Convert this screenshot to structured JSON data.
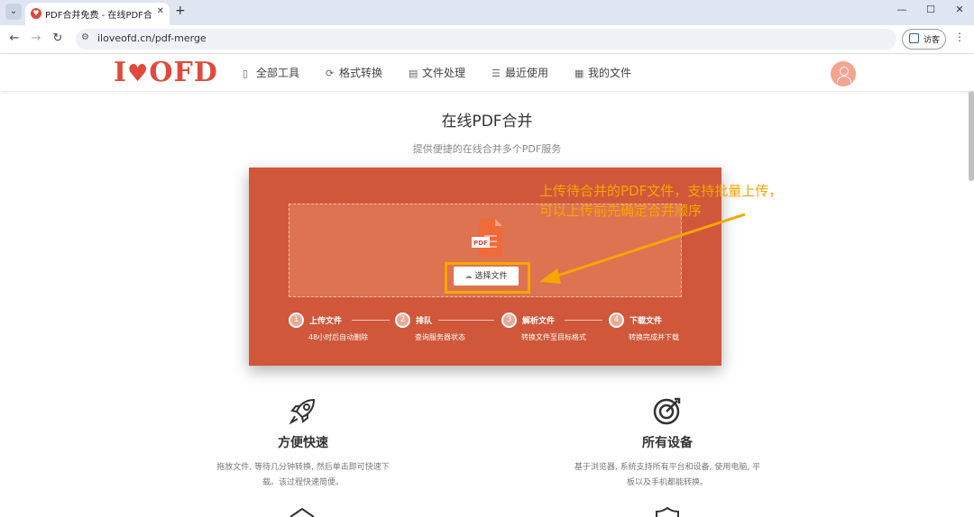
{
  "browser": {
    "tab_title": "PDF合并免费 - 在线PDF合并工",
    "url": "iloveofd.cn/pdf-merge",
    "guest_label": "访客"
  },
  "site": {
    "logo_text_1": "I",
    "logo_text_2": "OFD",
    "nav": [
      {
        "label": "全部工具",
        "icon": "grid-icon"
      },
      {
        "label": "格式转换",
        "icon": "convert-icon"
      },
      {
        "label": "文件处理",
        "icon": "file-process-icon"
      },
      {
        "label": "最近使用",
        "icon": "recent-icon"
      },
      {
        "label": "我的文件",
        "icon": "my-files-icon"
      }
    ]
  },
  "main": {
    "title": "在线PDF合并",
    "subtitle": "提供便捷的在线合并多个PDF服务",
    "choose_file": "选择文件",
    "pdf_badge": "PDF",
    "steps": [
      {
        "num": "1",
        "title": "上传文件",
        "desc": "48小时后自动删除"
      },
      {
        "num": "2",
        "title": "排队",
        "desc": "查询服务器状态"
      },
      {
        "num": "3",
        "title": "解析文件",
        "desc": "转换文件至目标格式"
      },
      {
        "num": "4",
        "title": "下载文件",
        "desc": "转换完成并下载"
      }
    ],
    "annotation_line1": "上传待合并的PDF文件，支持批量上传，",
    "annotation_line2": "可以上传前先确定合并顺序"
  },
  "features": [
    {
      "title": "方便快速",
      "desc_line1": "拖放文件, 等待几分钟转换, 然后单击即可快速下",
      "desc_line2": "载。该过程快速简便。",
      "icon": "rocket-icon"
    },
    {
      "title": "所有设备",
      "desc_line1": "基于浏览器, 系统支持所有平台和设备, 使用电脑, 平",
      "desc_line2": "板以及手机都能转换。",
      "icon": "target-icon"
    }
  ],
  "colors": {
    "brand": "#e0493d",
    "panel": "#d0573a",
    "dropzone": "#dd7351",
    "annotation": "#f5a700"
  }
}
